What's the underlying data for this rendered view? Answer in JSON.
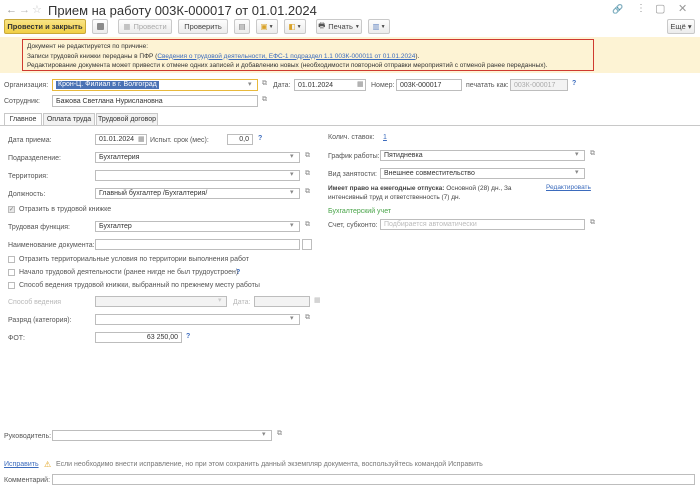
{
  "window": {
    "title": "Прием на работу 003К-000017 от 01.01.2024",
    "star": "☆"
  },
  "toolbar": {
    "post_close": "Провести и закрыть",
    "post": "Провести",
    "check": "Проверить",
    "print": "Печать"
  },
  "warning": {
    "line1": "Документ не редактируется по причине:",
    "line2_prefix": "Записи трудовой книжки переданы в ПФР (",
    "line2_link": "Сведения о трудовой деятельности, ЕФС-1 подраздел 1.1 003К-000011 от 01.01.2024",
    "line2_suffix": ").",
    "line3": "Редактирование документа может привести к отмене одних записей и добавлению новых (необходимости повторной отправки мероприятий с отменой ранее переданных)."
  },
  "header": {
    "org_label": "Организация:",
    "org_value": "Крон-Ц. Филиал в г. Волгоград",
    "date_label": "Дата:",
    "date_value": "01.01.2024",
    "number_label": "Номер:",
    "number_value": "003К-000017",
    "print_as_label": "печатать как:",
    "print_as_value": "003К-000017",
    "employee_label": "Сотрудник:",
    "employee_value": "Бажова Светлана Нурислановна"
  },
  "tabs": [
    "Главное",
    "Оплата труда",
    "Трудовой договор"
  ],
  "left": {
    "hire_date_label": "Дата приема:",
    "hire_date_value": "01.01.2024",
    "trial_label": "Испыт. срок (мес):",
    "trial_value": "0,0",
    "dept_label": "Подразделение:",
    "dept_value": "Бухгалтерия",
    "territory_label": "Территория:",
    "territory_value": "",
    "position_label": "Должность:",
    "position_value": "Главный бухгалтер /Бухгалтерия/",
    "reflect_label": "Отразить в трудовой книжке",
    "function_label": "Трудовая функция:",
    "function_value": "Бухгалтер",
    "docname_label": "Наименование документа:",
    "docname_value": "",
    "cb1": "Отразить территориальные условия по территории выполнения работ",
    "cb2": "Начало трудовой деятельности (ранее нигде не был трудоустроен)",
    "cb3": "Способ ведения трудовой книжки, выбранный по прежнему месту работы",
    "method_label": "Способ ведения",
    "method_date_label": "Дата:",
    "rank_label": "Разряд (категория):",
    "fot_label": "ФОТ:",
    "fot_value": "63 250,00"
  },
  "right": {
    "rates_label": "Колич. ставок:",
    "rates_value": "1",
    "schedule_label": "График работы:",
    "schedule_value": "Пятидневка",
    "employment_label": "Вид занятости:",
    "employment_value": "Внешнее совместительство",
    "vacation_bold": "Имеет право на ежегодные отпуска:",
    "vacation_text1": "Основной (28) дн., За",
    "vacation_text2": "интенсивный труд и ответственность (7) дн.",
    "edit_link": "Редактировать",
    "accounting_label": "Бухгалтерский учет",
    "account_label": "Счет, субконто:",
    "account_placeholder": "Подбирается автоматически"
  },
  "footer": {
    "manager_label": "Руководитель:",
    "manager_value": "",
    "fix_link": "Исправить",
    "fix_note": "Если необходимо внести исправление, но при этом сохранить данный экземпляр документа, воспользуйтесь командой Исправить",
    "comment_label": "Комментарий:",
    "comment_value": ""
  }
}
